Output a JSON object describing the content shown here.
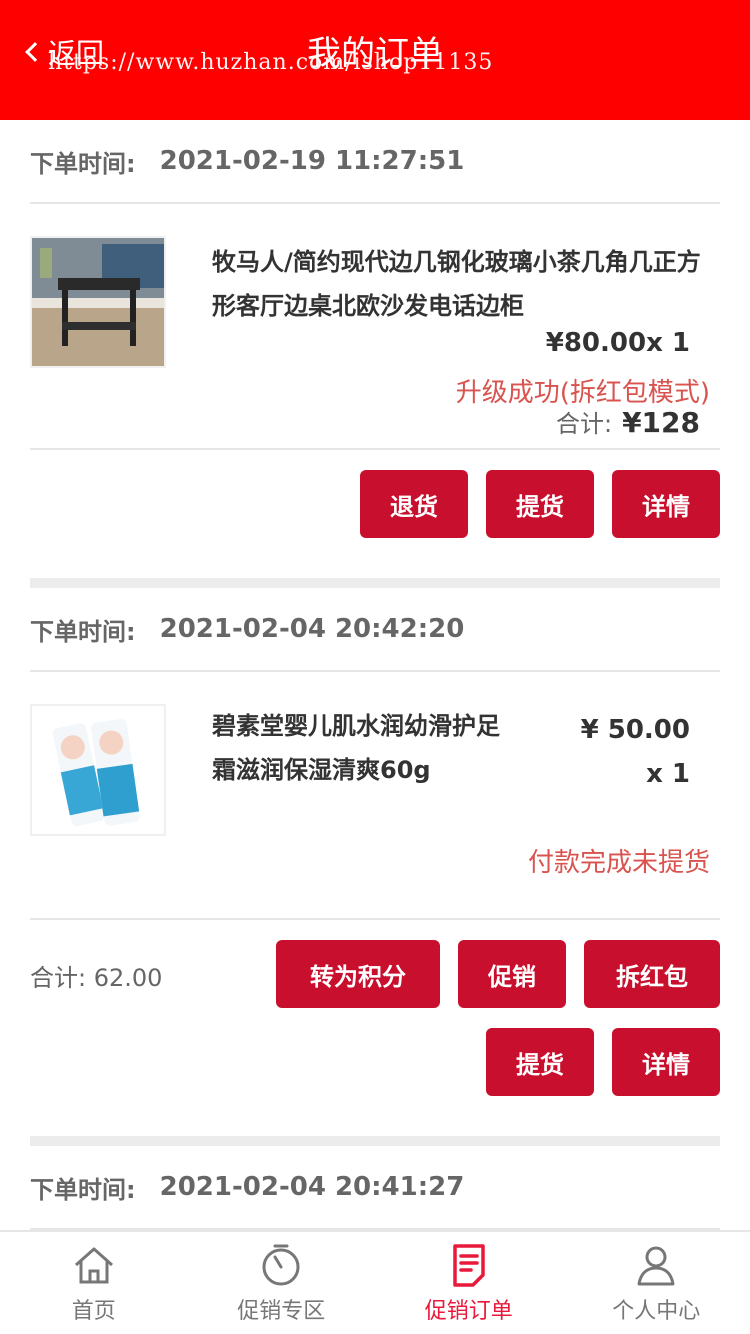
{
  "header": {
    "back_label": "返回",
    "title": "我的订单",
    "watermark": "https://www.huzhan.com/ishop11135"
  },
  "orders": [
    {
      "time_label": "下单时间:",
      "time": "2021-02-19 11:27:51",
      "product_name": "牧马人/简约现代边几钢化玻璃小茶几角几正方形客厅边桌北欧沙发电话边柜",
      "price_qty": "¥80.00x 1",
      "status": "升级成功(拆红包模式)",
      "total_label": "合计:",
      "total_value": "¥128",
      "buttons": [
        "退货",
        "提货",
        "详情"
      ]
    },
    {
      "time_label": "下单时间:",
      "time": "2021-02-04 20:42:20",
      "product_name": "碧素堂婴儿肌水润幼滑护足霜滋润保湿清爽60g",
      "price": "¥ 50.00",
      "qty": "x 1",
      "status": "付款完成未提货",
      "total_text": "合计: 62.00",
      "buttons_row1": [
        "转为积分",
        "促销",
        "拆红包"
      ],
      "buttons_row2": [
        "提货",
        "详情"
      ]
    },
    {
      "time_label": "下单时间:",
      "time": "2021-02-04 20:41:27"
    }
  ],
  "tabbar": {
    "items": [
      {
        "label": "首页",
        "icon": "home-icon"
      },
      {
        "label": "促销专区",
        "icon": "timer-icon"
      },
      {
        "label": "促销订单",
        "icon": "order-icon",
        "active": true
      },
      {
        "label": "个人中心",
        "icon": "user-icon"
      }
    ]
  },
  "colors": {
    "header": "#ff0000",
    "button": "#c8102e",
    "status_text": "#d9534f",
    "tab_active": "#e8193a"
  }
}
